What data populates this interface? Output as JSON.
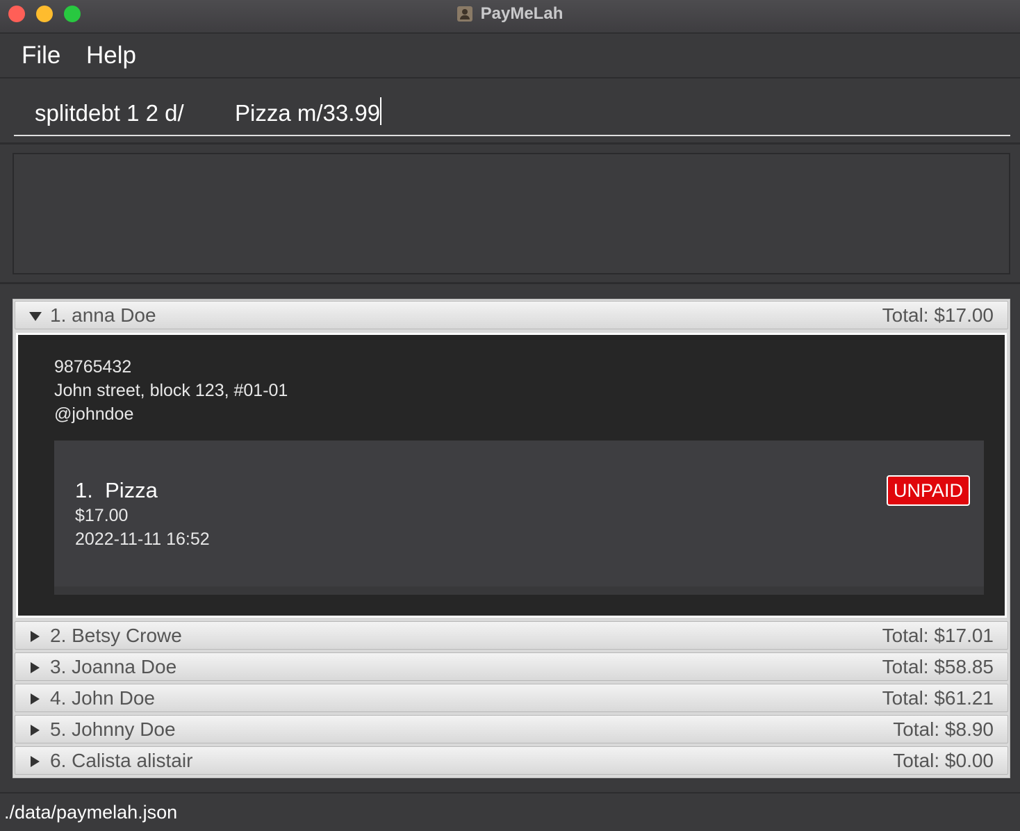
{
  "window": {
    "title": "PayMeLah",
    "title_icon": "contacts-app-icon"
  },
  "menu": {
    "file": "File",
    "help": "Help"
  },
  "command": {
    "value": "splitdebt 1 2 d/        Pizza m/33.99"
  },
  "result": {
    "text": ""
  },
  "persons": [
    {
      "name": "1. anna Doe",
      "total": "Total: $17.00",
      "expanded": true,
      "phone": "98765432",
      "address": "John street, block 123, #01-01",
      "telegram": "@johndoe",
      "debts": [
        {
          "title": "1.  Pizza",
          "amount": "$17.00",
          "datetime": "2022-11-11 16:52",
          "status": "UNPAID"
        }
      ]
    },
    {
      "name": "2. Betsy Crowe",
      "total": "Total: $17.01",
      "expanded": false
    },
    {
      "name": "3. Joanna Doe",
      "total": "Total: $58.85",
      "expanded": false
    },
    {
      "name": "4. John Doe",
      "total": "Total: $61.21",
      "expanded": false
    },
    {
      "name": "5. Johnny Doe",
      "total": "Total: $8.90",
      "expanded": false
    },
    {
      "name": "6. Calista alistair",
      "total": "Total: $0.00",
      "expanded": false
    }
  ],
  "status_bar": {
    "path": "./data/paymelah.json"
  },
  "colors": {
    "unpaid_badge": "#e0060b",
    "background": "#3a3a3c"
  }
}
